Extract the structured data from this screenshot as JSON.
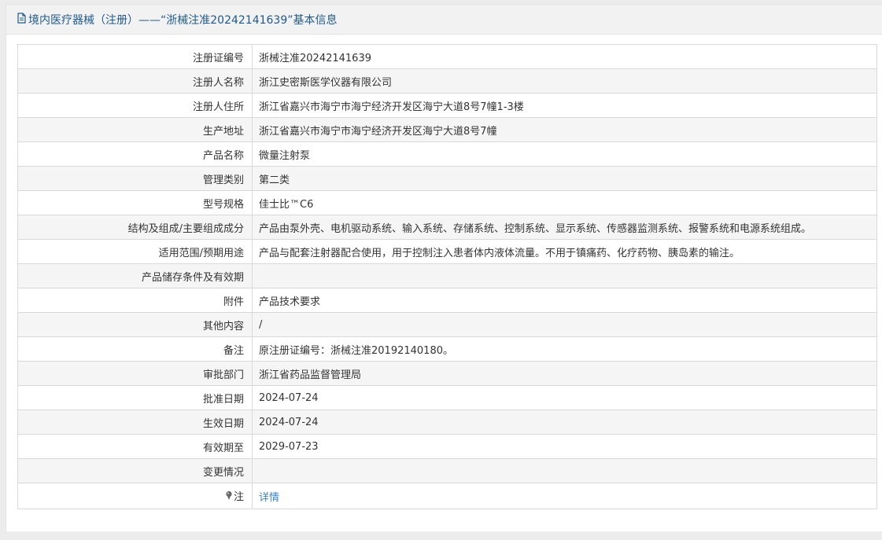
{
  "header": {
    "icon": "document-icon",
    "title": "境内医疗器械（注册）——“浙械注准20242141639”基本信息"
  },
  "rows": [
    {
      "label": "注册证编号",
      "value": "浙械注准20242141639"
    },
    {
      "label": "注册人名称",
      "value": "浙江史密斯医学仪器有限公司"
    },
    {
      "label": "注册人住所",
      "value": "浙江省嘉兴市海宁市海宁经济开发区海宁大道8号7幢1-3楼"
    },
    {
      "label": "生产地址",
      "value": "浙江省嘉兴市海宁市海宁经济开发区海宁大道8号7幢"
    },
    {
      "label": "产品名称",
      "value": "微量注射泵"
    },
    {
      "label": "管理类别",
      "value": "第二类"
    },
    {
      "label": "型号规格",
      "value": "佳士比™C6"
    },
    {
      "label": "结构及组成/主要组成成分",
      "value": "产品由泵外壳、电机驱动系统、输入系统、存储系统、控制系统、显示系统、传感器监测系统、报警系统和电源系统组成。"
    },
    {
      "label": "适用范围/预期用途",
      "value": "产品与配套注射器配合使用，用于控制注入患者体内液体流量。不用于镇痛药、化疗药物、胰岛素的输注。"
    },
    {
      "label": "产品储存条件及有效期",
      "value": ""
    },
    {
      "label": "附件",
      "value": "产品技术要求"
    },
    {
      "label": "其他内容",
      "value": "/"
    },
    {
      "label": "备注",
      "value": "原注册证编号：浙械注准20192140180。"
    },
    {
      "label": "审批部门",
      "value": "浙江省药品监督管理局"
    },
    {
      "label": "批准日期",
      "value": "2024-07-24"
    },
    {
      "label": "生效日期",
      "value": "2024-07-24"
    },
    {
      "label": "有效期至",
      "value": "2029-07-23"
    },
    {
      "label": "变更情况",
      "value": ""
    }
  ],
  "note": {
    "icon": "pin-icon",
    "label": "注",
    "link": "详情"
  },
  "colors": {
    "header_text": "#1e5a8e",
    "link": "#3a82c4"
  }
}
